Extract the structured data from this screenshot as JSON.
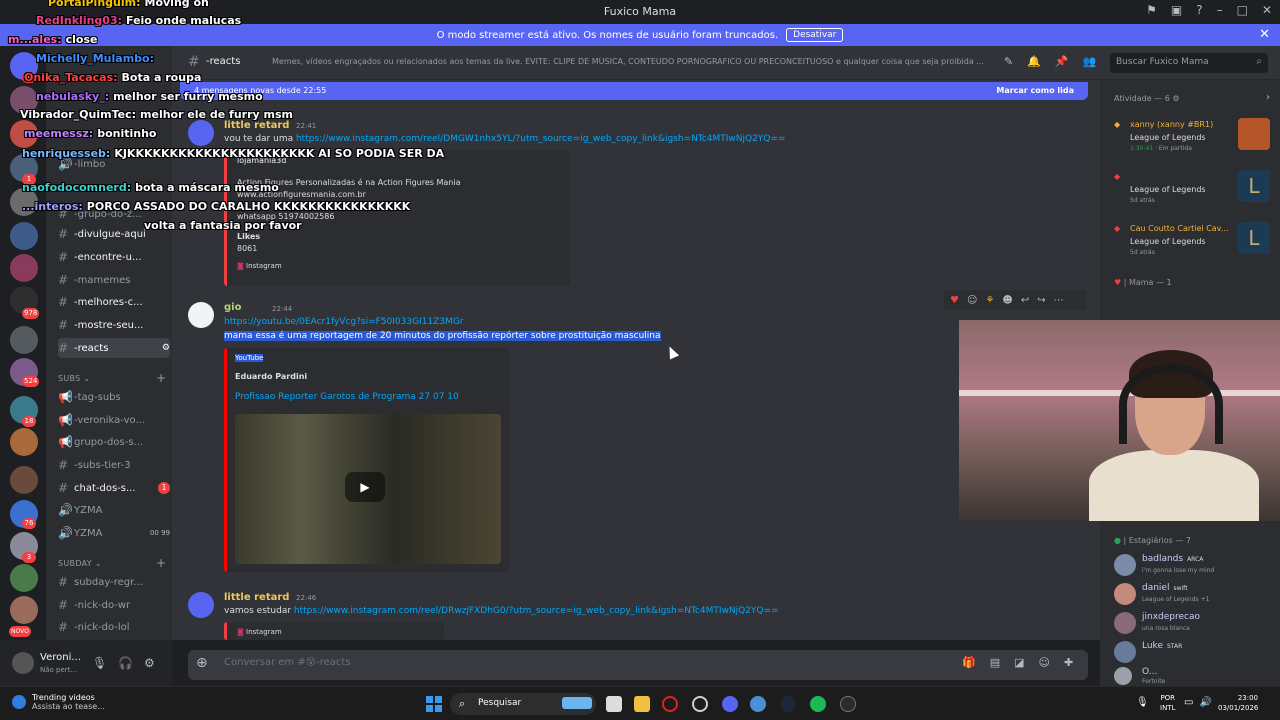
{
  "window": {
    "title": "Fuxico Mama"
  },
  "banner": {
    "text": "O modo streamer está ativo. Os nomes de usuário foram truncados.",
    "button": "Desativar"
  },
  "guild_badges": [
    "4",
    "1",
    "978",
    "524",
    "18",
    "76",
    "3",
    "NOVO"
  ],
  "channels": {
    "items": [
      {
        "label": "-limbo"
      },
      {
        "label": "-grupo-do-z..."
      },
      {
        "label": "-divulgue-aqui"
      },
      {
        "label": "-encontre-u..."
      },
      {
        "label": "-mamemes"
      },
      {
        "label": "-melhores-c..."
      },
      {
        "label": "-mostre-seu..."
      },
      {
        "label": "-reacts"
      }
    ],
    "subs_category": "SUBS",
    "subs": [
      {
        "label": "-tag-subs"
      },
      {
        "label": "-veronika-vo..."
      },
      {
        "label": "grupo-dos-s..."
      },
      {
        "label": "-subs-tier-3"
      },
      {
        "label": "chat-dos-s...",
        "badge": "1"
      },
      {
        "label": "YZMA"
      },
      {
        "label": "YZMA",
        "extra": "00  99"
      }
    ],
    "subday_category": "SUBDAY",
    "subday": [
      {
        "label": "subday-regr..."
      },
      {
        "label": "-nick-do-wr"
      },
      {
        "label": "-nick-do-lol"
      }
    ]
  },
  "user_panel": {
    "name": "Veroni...",
    "status": "Não pert..."
  },
  "header": {
    "channel": "-reacts",
    "topic": "Memes, vídeos engraçados ou relacionados aos temas da live. EVITE: CLIPE DE MÚSICA, CONTEUDO PORNOGRAFICO OU PRECONCEITUOSO e qualquer coisa que seja proibida ...",
    "search_placeholder": "Buscar Fuxico Mama"
  },
  "new_messages": {
    "text": "4 mensagens novas desde 22:55",
    "action": "Marcar como lida"
  },
  "messages": [
    {
      "author": "little retard",
      "time": "22:41",
      "text_prefix": "vou te dar uma ",
      "link": "https://www.instagram.com/reel/DMGW1nhx5YL/?utm_source=ig_web_copy_link&igsh=NTc4MTIwNjQ2YQ==",
      "embed": {
        "account": "lojamania3d",
        "line1": "Action Figures Personalizadas é na Action Figures Mania",
        "line2": "www.actionfiguresmania.com.br",
        "line3": "whatsapp 51974002586",
        "likes_label": "Likes",
        "likes": "8061",
        "provider": "Instagram"
      }
    },
    {
      "author": "gio",
      "time": "22:44",
      "link": "https://youtu.be/0EAcr1fyVcg?si=F50I033GI11Z3MGr",
      "text": "mama essa é uma reportagem de 20 minutos do profissão repórter sobre prostituição masculina",
      "embed": {
        "provider": "YouTube",
        "author": "Eduardo Pardini",
        "title": "Profissao Reporter  Garotos de Programa 27 07 10"
      }
    },
    {
      "author": "little retard",
      "time": "22:46",
      "text_prefix": "vamos estudar ",
      "link": "https://www.instagram.com/reel/DRwzjFXDhG0/?utm_source=ig_web_copy_link&igsh=NTc4MTIwNjQ2YQ==",
      "embed": {
        "provider": "Instagram"
      }
    }
  ],
  "composer": {
    "placeholder": "Conversar em #😵-reacts"
  },
  "activity": {
    "header": "Atividade — 6",
    "items": [
      {
        "name": "xanny (xanny #BR1)",
        "game": "League of Legends",
        "time": "1:30:41",
        "status": "Em partida"
      },
      {
        "name": "",
        "game": "League of Legends",
        "time": "5d atrás"
      },
      {
        "name": "Cau Coutto Cartiel Cav...",
        "game": "League of Legends",
        "time": "5d atrás"
      }
    ],
    "mama_header": "Mama — 1",
    "estagiarios_header": "Estagiários — 7",
    "members": [
      {
        "name": "badlands",
        "tag": "ARCA",
        "status": "i'm gonna lose my mind"
      },
      {
        "name": "daniel",
        "tag": "swift",
        "status": "League of Legends +1"
      },
      {
        "name": "jinxdeprecao",
        "tag": "",
        "status": "una rosa blanca"
      },
      {
        "name": "Luke",
        "tag": "STAR",
        "status": ""
      },
      {
        "name": "O...",
        "tag": "",
        "status": "Fortnite"
      }
    ]
  },
  "stream_chat": [
    {
      "user": "PortalPinguim:",
      "text": "Moving on",
      "color": "#f5c400"
    },
    {
      "user": "RedInkling03:",
      "text": "Feio onde malucas",
      "color": "#e83e8c"
    },
    {
      "user": "m...ales:",
      "text": "close",
      "color": "#ff5ac8"
    },
    {
      "user": "Michelly_Mulambo:",
      "text": "",
      "color": "#3f8cff"
    },
    {
      "user": "Onika_Tacacas:",
      "text": "Bota a roupa",
      "color": "#ff4040"
    },
    {
      "user": "nebulasky_:",
      "text": "melhor ser furry mesmo",
      "color": "#b26bff"
    },
    {
      "user": "Vibrador_QuimTec:",
      "text": "melhor ele de furry msm",
      "color": "#ffffff"
    },
    {
      "user": "meemessz:",
      "text": "bonitinho",
      "color": "#c084fc"
    },
    {
      "user": "henriquesseb:",
      "text": "KJKKKKKKKKKKKKKKKKKKKKKK AI SO PODIA SER DA",
      "color": "#7ab8ff"
    },
    {
      "user": "naofodocomnerd:",
      "text": "bota a máscara mesmo",
      "color": "#3fd0d0"
    },
    {
      "user": "...interos:",
      "text": "PORCO ASSADO DO CARALHO KKKKKKKKKKKKKKKK",
      "color": "#a0a0ff"
    },
    {
      "user": "",
      "text": "volta a fantasia por favor",
      "color": "#ffffff"
    }
  ],
  "taskbar": {
    "weather_title": "Trending videos",
    "weather_sub": "Assista ao tease...",
    "search": "Pesquisar",
    "lang1": "POR",
    "lang2": "INTL",
    "time": "23:00",
    "date": "03/01/2026"
  },
  "colors": {
    "blurple": "#5865f2",
    "bg": "#313338",
    "sidebar": "#2b2d31",
    "link": "#00a8fc",
    "red": "#f23f42"
  }
}
